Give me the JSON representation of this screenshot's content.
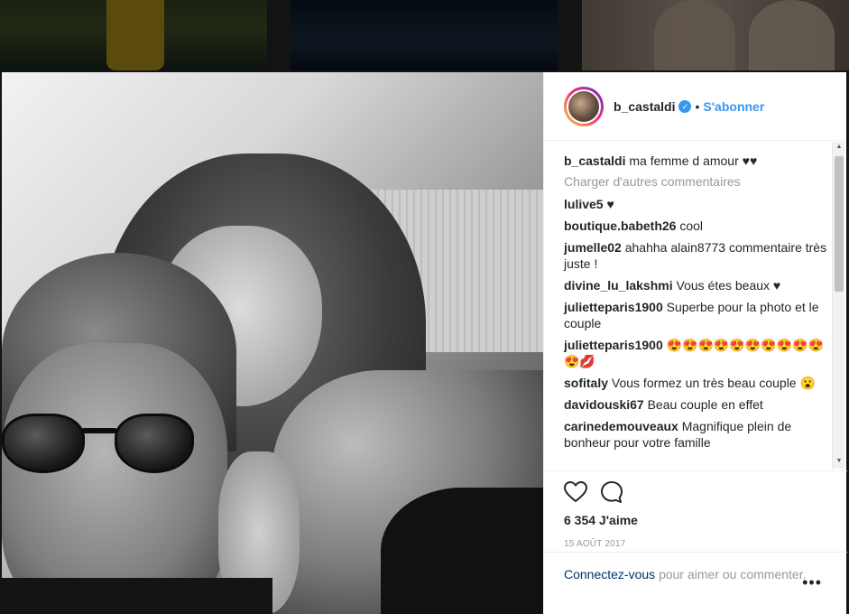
{
  "post": {
    "username": "b_castaldi",
    "separator": "•",
    "follow_label": "S'abonner",
    "caption": {
      "user": "b_castaldi",
      "text": "ma femme d amour ♥♥"
    },
    "load_more": "Charger d'autres commentaires",
    "comments": [
      {
        "user": "lulive5",
        "text": "♥"
      },
      {
        "user": "boutique.babeth26",
        "text": "cool"
      },
      {
        "user": "jumelle02",
        "text": "ahahha alain8773 commentaire très juste !"
      },
      {
        "user": "divine_lu_lakshmi",
        "text": "Vous étes beaux ♥"
      },
      {
        "user": "julietteparis1900",
        "text": "Superbe pour la photo et le couple"
      },
      {
        "user": "julietteparis1900",
        "text": "😍😍😍😍😍😍😍😍😍😍😍💋"
      },
      {
        "user": "sofitaly",
        "text": "Vous formez un très beau couple 😮"
      },
      {
        "user": "davidouski67",
        "text": "Beau couple en effet"
      },
      {
        "user": "carinedemouveaux",
        "text": "Magnifique plein de bonheur pour votre famille"
      }
    ],
    "likes_text": "6 354 J'aime",
    "date": "15 AOÛT 2017",
    "login_link": "Connectez-vous",
    "login_rest": "pour aimer ou commenter.",
    "more_label": "•••",
    "icons": [
      "heart-icon",
      "comment-icon",
      "verified-icon",
      "more-options-icon"
    ],
    "colors": {
      "link_blue": "#3897f0",
      "dark_link": "#003569",
      "muted": "#999999"
    }
  }
}
